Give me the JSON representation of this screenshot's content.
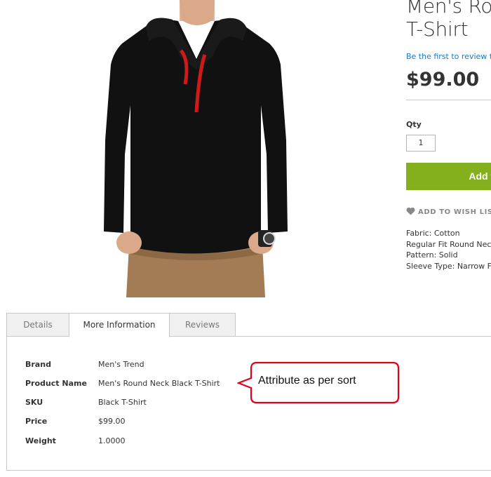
{
  "product": {
    "title_line1": "Men's Round",
    "title_line2": "T-Shirt",
    "review_link": "Be the first to review this product",
    "price": "$99.00",
    "qty_label": "Qty",
    "qty_value": "1",
    "add_to_cart": "Add to Cart",
    "wishlist": "ADD TO WISH LIST",
    "specs": [
      "Fabric: Cotton",
      "Regular Fit Round Neck T-Shirt",
      "Pattern: Solid",
      "Sleeve Type: Narrow Full Sleeve"
    ]
  },
  "tabs": [
    {
      "label": "Details",
      "active": false
    },
    {
      "label": "More Information",
      "active": true
    },
    {
      "label": "Reviews",
      "active": false
    }
  ],
  "attributes": [
    {
      "label": "Brand",
      "value": "Men's Trend"
    },
    {
      "label": "Product Name",
      "value": "Men's Round Neck Black T-Shirt"
    },
    {
      "label": "SKU",
      "value": "Black T-Shirt"
    },
    {
      "label": "Price",
      "value": "$99.00"
    },
    {
      "label": "Weight",
      "value": "1.0000"
    }
  ],
  "callout": {
    "text": "Attribute as per sort"
  },
  "colors": {
    "accent_green": "#83b01c",
    "link_blue": "#1979c3",
    "callout_border": "#e0001a"
  },
  "icons": {
    "wishlist": "heart-icon"
  }
}
